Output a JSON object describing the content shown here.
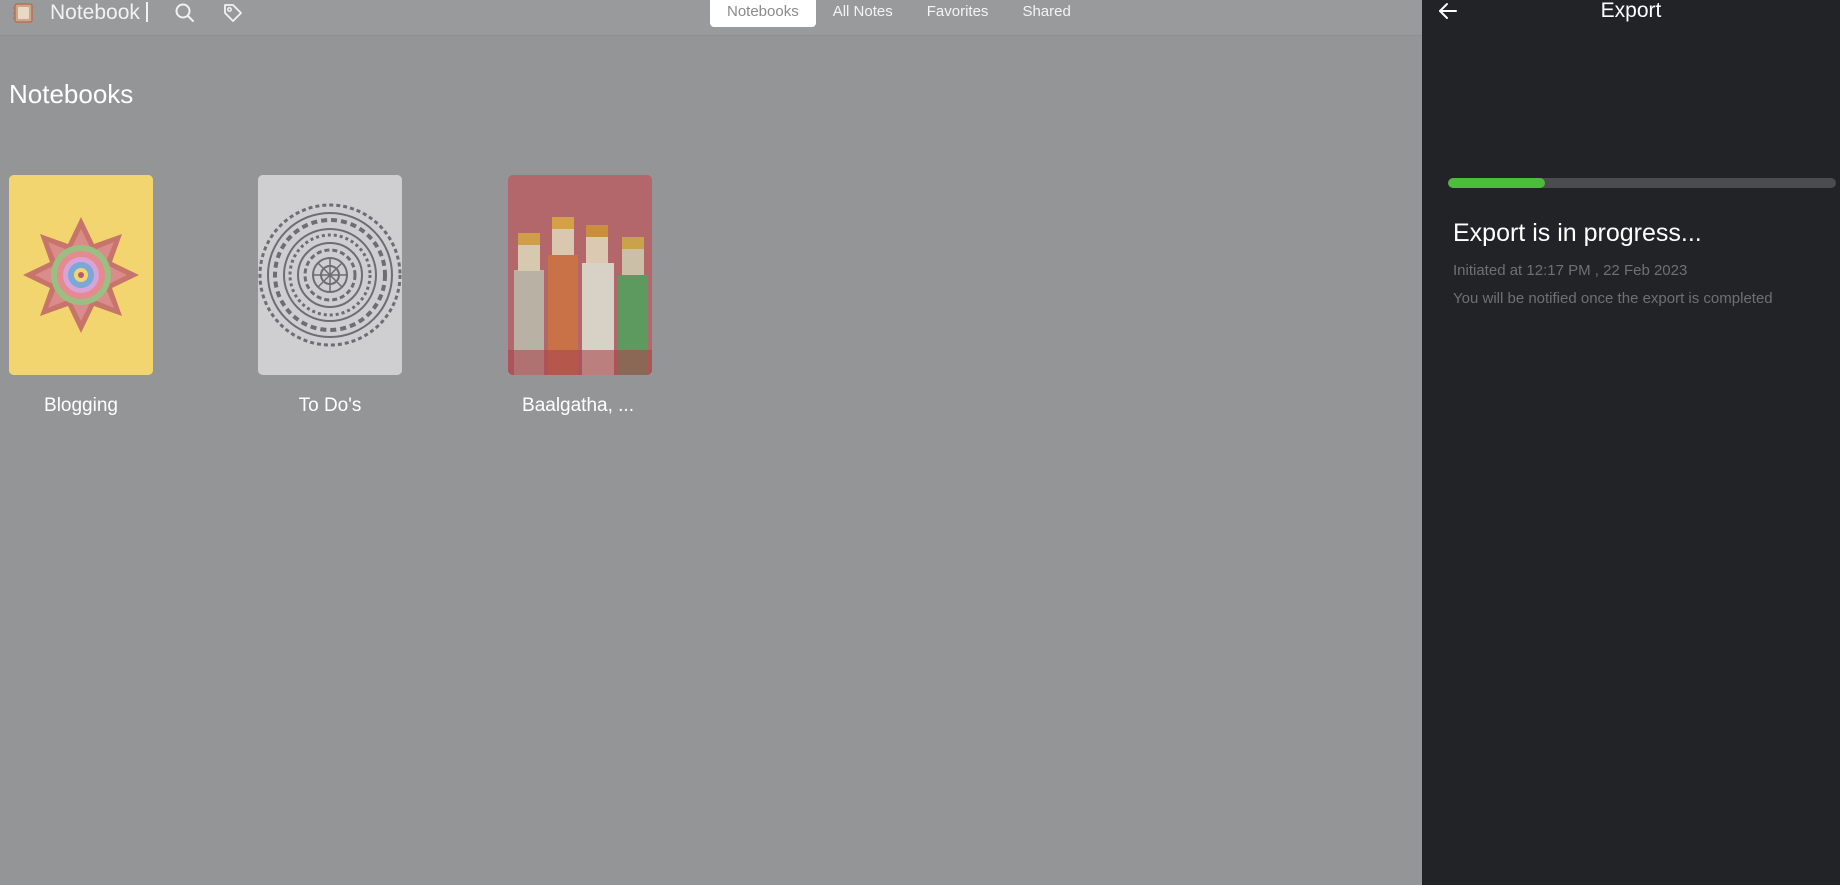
{
  "app": {
    "title": "Notebook"
  },
  "tabs": [
    {
      "label": "Notebooks",
      "active": true
    },
    {
      "label": "All Notes",
      "active": false
    },
    {
      "label": "Favorites",
      "active": false
    },
    {
      "label": "Shared",
      "active": false
    }
  ],
  "main": {
    "section_title": "Notebooks",
    "notebooks": [
      {
        "title": "Blogging",
        "cover": "yellow-mandala"
      },
      {
        "title": "To Do's",
        "cover": "grey-mandala"
      },
      {
        "title": "Baalgatha, ...",
        "cover": "puppets"
      }
    ]
  },
  "export_panel": {
    "title": "Export",
    "progress": 0.25,
    "status_title": "Export is in progress...",
    "initiated_text": "Initiated at 12:17 PM , 22 Feb 2023",
    "note_text": "You will be notified once the export is completed"
  },
  "icons": {
    "logo": "notebook-logo-icon",
    "search": "search-icon",
    "tag": "tag-icon",
    "back": "arrow-left-icon"
  },
  "colors": {
    "progress_fill": "#4cbc3c",
    "panel_bg": "#222326",
    "overlay_bg": "#949597"
  }
}
